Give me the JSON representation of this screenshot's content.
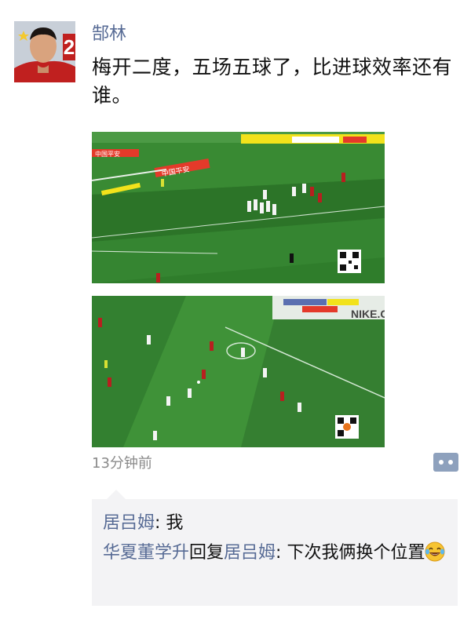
{
  "post": {
    "author": "郜林",
    "avatar_jersey_number": "2",
    "text": "梅开二度，五场五球了，比进球效率还有谁。",
    "timestamp": "13分钟前"
  },
  "media": [
    {
      "label": "free-kick-video-still",
      "board_texts": [
        "中国平安",
        "中国平安"
      ]
    },
    {
      "label": "open-play-video-still",
      "board_texts": [
        "NIKE.C"
      ]
    }
  ],
  "comments": [
    {
      "author": "居吕姆",
      "separator": ": ",
      "text": "我"
    },
    {
      "author": "华夏董学升",
      "reply_word": "回复",
      "reply_to": "居吕姆",
      "separator": ": ",
      "text": "下次我俩换个位置",
      "emoji": "laughing-tears-emoji"
    }
  ],
  "icons": {
    "more_button": "comment-more-icon"
  },
  "colors": {
    "name_link": "#576b95",
    "comment_bg": "#f3f3f5",
    "pitch_green": "#2f7d2b"
  }
}
